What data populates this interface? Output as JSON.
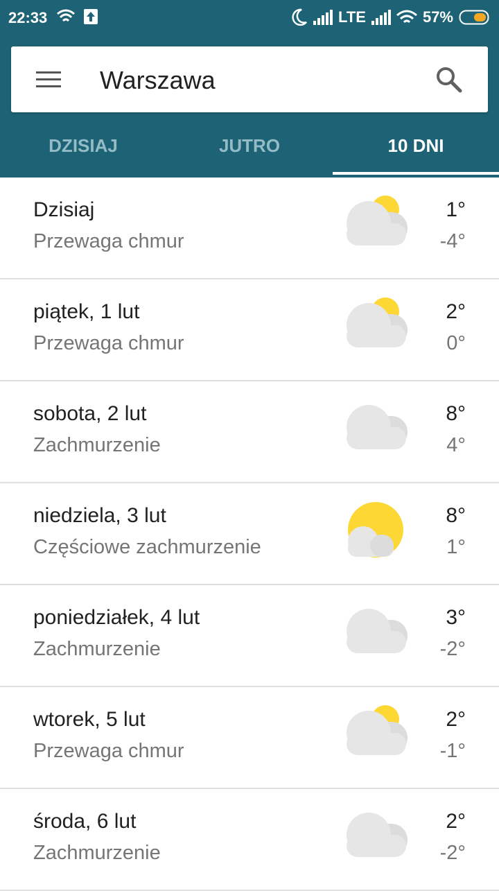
{
  "status_bar": {
    "time": "22:33",
    "network": "LTE",
    "battery": "57%"
  },
  "search": {
    "city": "Warszawa"
  },
  "tabs": [
    {
      "label": "DZISIAJ"
    },
    {
      "label": "JUTRO"
    },
    {
      "label": "10 DNI"
    }
  ],
  "active_tab": "10 DNI",
  "forecast": [
    {
      "day": "Dzisiaj",
      "condition": "Przewaga chmur",
      "high": "1°",
      "low": "-4°",
      "icon": "mostly-cloudy-icon"
    },
    {
      "day": "piątek, 1 lut",
      "condition": "Przewaga chmur",
      "high": "2°",
      "low": "0°",
      "icon": "mostly-cloudy-icon"
    },
    {
      "day": "sobota, 2 lut",
      "condition": "Zachmurzenie",
      "high": "8°",
      "low": "4°",
      "icon": "cloudy-icon"
    },
    {
      "day": "niedziela, 3 lut",
      "condition": "Częściowe zachmurzenie",
      "high": "8°",
      "low": "1°",
      "icon": "partly-cloudy-icon"
    },
    {
      "day": "poniedziałek, 4 lut",
      "condition": "Zachmurzenie",
      "high": "3°",
      "low": "-2°",
      "icon": "cloudy-icon"
    },
    {
      "day": "wtorek, 5 lut",
      "condition": "Przewaga chmur",
      "high": "2°",
      "low": "-1°",
      "icon": "mostly-cloudy-icon"
    },
    {
      "day": "środa, 6 lut",
      "condition": "Zachmurzenie",
      "high": "2°",
      "low": "-2°",
      "icon": "cloudy-icon"
    }
  ],
  "colors": {
    "app_bar": "#1d6375",
    "sun": "#fdd835",
    "cloud": "#e6e6e6"
  }
}
